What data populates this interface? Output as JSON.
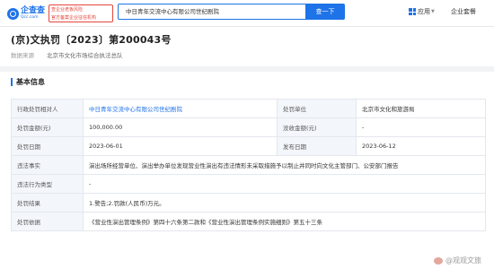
{
  "header": {
    "logo_cn": "企查查",
    "logo_en": "Qcc.com",
    "slogan_line1": "查企业老板风险",
    "slogan_line2": "官方备案企业征信机构",
    "search_value": "中日青年交流中心有限公司世纪剧院",
    "search_button": "查一下",
    "apps_label": "应用",
    "pro_label": "企业套餐"
  },
  "document": {
    "title": "(京)文执罚〔2023〕第200043号",
    "source_label": "数据来源",
    "source_value": "北京市文化市场综合执法总队"
  },
  "section": {
    "title": "基本信息"
  },
  "table": {
    "r1": {
      "label": "行政处罚相对人",
      "value": "中日青年交流中心有限公司世纪剧院",
      "label2": "处罚单位",
      "value2": "北京市文化和旅游局"
    },
    "r2": {
      "label": "处罚金额(元)",
      "value": "100,000.00",
      "label2": "没收金额(元)",
      "value2": "-"
    },
    "r3": {
      "label": "处罚日期",
      "value": "2023-06-01",
      "label2": "发布日期",
      "value2": "2023-06-12"
    },
    "r4": {
      "label": "违法事实",
      "value": "演出场所经营单位、演出举办单位发现营业性演出有违法情形未采取措施予以制止并同时向文化主管部门、公安部门报告"
    },
    "r5": {
      "label": "违法行为类型",
      "value": "-"
    },
    "r6": {
      "label": "处罚结果",
      "value": "1.警告;2.罚款(人民币)万元。"
    },
    "r7": {
      "label": "处罚依据",
      "value": "《营业性演出管理条例》第四十六条第二款和《营业性演出管理条例实施细则》第五十三条"
    }
  },
  "watermark": "@观观文旅"
}
